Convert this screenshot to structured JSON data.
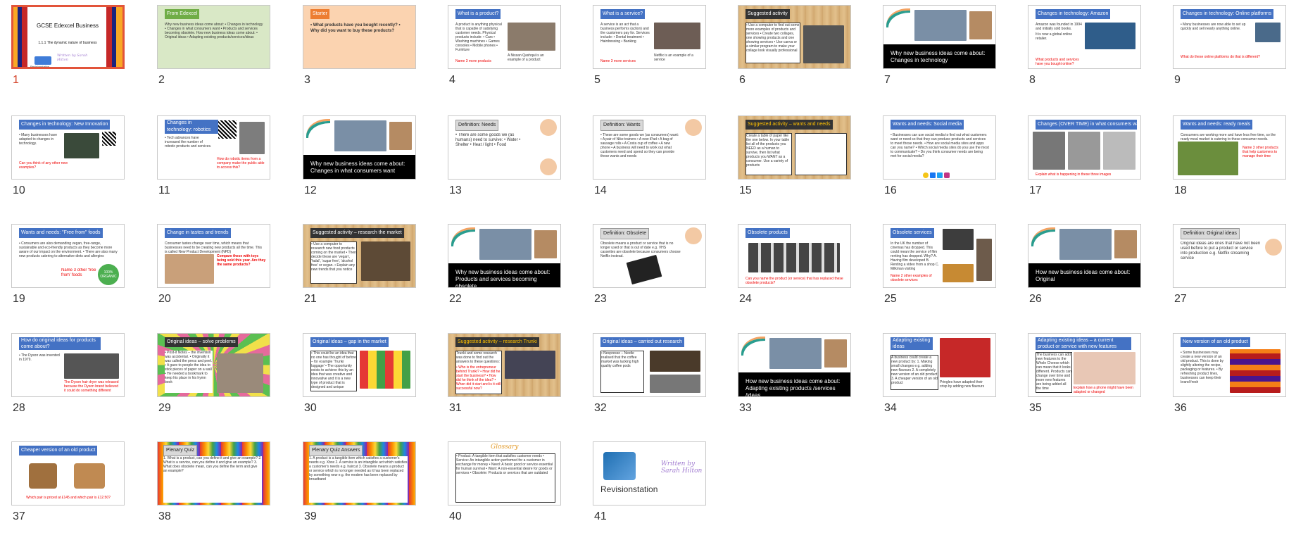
{
  "slides": [
    {
      "number": "1",
      "title": "GCSE Edexcel Business",
      "subtitle": "1.1.1 The dynamic nature of business",
      "brand": "Revisionstation",
      "signature": "Written by Sarah Hilton"
    },
    {
      "number": "2",
      "title": "From Edexcel",
      "body": "Why new business ideas come about: • Changes in technology • Changes in what consumers want • Products and services becoming obsolete. How new business ideas come about: • Original ideas • Adapting existing products/services/ideas"
    },
    {
      "number": "3",
      "title": "Starter",
      "body": "• What products have you bought recently? • Why did you want to buy these products?"
    },
    {
      "number": "4",
      "title": "What is a product?",
      "body": "A product is anything physical that is capable of satisfying customer needs. Physical products include: • Cars • Washing machines • Games consoles • Mobile phones • Furniture",
      "footer": "Name 3 more products",
      "caption": "A Nissan Qashqai is an example of a product"
    },
    {
      "number": "5",
      "title": "What is a service?",
      "body": "A service is an act that a business performs (action) and the customers pay for. Services include: • Dental treatment • Hairdressing • Banking",
      "footer": "Name 3 more services",
      "caption": "Netflix is an example of a service"
    },
    {
      "number": "6",
      "title": "Suggested activity",
      "body": "• Use a computer to find out some more examples of products and services • Create two collages, one showing products and one showing services • Use canva or a similar program to make your collage look visually professional"
    },
    {
      "number": "7",
      "body": "Why new business ideas come about: Changes in technology"
    },
    {
      "number": "8",
      "title": "Changes in technology: Amazon",
      "footer": "What products and services have you bought online?"
    },
    {
      "number": "9",
      "title": "Changes in technology: Online platforms",
      "footer": "What do these online platforms do that is different?"
    },
    {
      "number": "10",
      "title": "Changes in technology: New Innovation",
      "footer": "Can you think of any other new examples?"
    },
    {
      "number": "11",
      "title": "Changes in technology: robotics",
      "footer": "How do robotic items from a company make the public able to access this?"
    },
    {
      "number": "12",
      "body": "Why new business ideas come about: Changes in what consumers want"
    },
    {
      "number": "13",
      "title": "Definition: Needs",
      "body": "• There are some goods we (as humans) need to survive: • Water • Shelter • Heat / light • Food"
    },
    {
      "number": "14",
      "title": "Definition: Wants",
      "body": "• These are some goods we (as consumers) want: • A pair of Nike trainers • A new iPad • A bag of sausage rolls • A Costa cup of coffee • A new phone • A business will need to work out what customers need and spend so they can provide these wants and needs"
    },
    {
      "number": "15",
      "title": "Suggested activity – wants and needs",
      "body": "Create a table of paper like the one below. In your table list all of the products you NEED as a human to survive, then list what products you WANT as a consumer. Use a variety of products"
    },
    {
      "number": "16",
      "title": "Wants and needs: Social media",
      "body": "• Businesses can use social media to find out what customers want or need so that they can produce products and services to meet those needs. • How are social media sites and apps can you name? • Which social media sites do you use the most to communicate? • Do you think consumer needs are being met for social media?"
    },
    {
      "number": "17",
      "title": "Changes (OVER TIME) in what consumers want",
      "footer": "Explain what is happening in these three images"
    },
    {
      "number": "18",
      "title": "Wants and needs: ready meals",
      "body": "Consumers are working more and have less free time, so the ready meal market is catering to these consumer needs.",
      "footer": "Name 3 other products that help customers to manage their time"
    },
    {
      "number": "19",
      "title": "Wants and needs: \"Free from\" foods",
      "body": "• Consumers are also demanding vegan, free-range, sustainable and eco-friendly products as they become more aware of our impact on the environment. • There are also many new products catering to alternative diets and allergies",
      "footer": "Name 3 other 'free from' foods",
      "badge": "100% ORGANIC"
    },
    {
      "number": "20",
      "title": "Change in tastes and trends",
      "body": "Consumer tastes change over time, which means that businesses need to be creating new products all the time. This is called New Product Development (NPD)",
      "footer": "Compare these with toys being sold this year. Are they the same products?"
    },
    {
      "number": "21",
      "title": "Suggested activity – research the market",
      "body": "• Use a computer to research new food products coming on the market • Then decide these are 'vegan', 'halal', 'sugar free', 'alcohol free' or vegan. • Explain any new trends that you notice"
    },
    {
      "number": "22",
      "body": "Why new business ideas come about: Products and services becoming obsolete"
    },
    {
      "number": "23",
      "title": "Definition: Obsolete",
      "body": "Obsolete means a product or service that is no longer used or that is out of date e.g. VHS cassettes are obsolete because consumers choose Netflix instead."
    },
    {
      "number": "24",
      "title": "Obsolete products",
      "footer": "Can you name the product (or service) that has replaced these obsolete products?"
    },
    {
      "number": "25",
      "title": "Obsolete services",
      "body": "In the UK the number of cinemas has dropped. This could mean the service of film renting has dropped. Why? A. Having film developed B. Renting a video from a shop C. Milkman visiting",
      "footer": "Name 2 other examples of obsolete services"
    },
    {
      "number": "26",
      "body": "How new business ideas come about: Original"
    },
    {
      "number": "27",
      "title": "Definition: Original ideas",
      "body": "Original ideas are ones that have not been used before to put a product or service into production e.g. Netflix streaming service"
    },
    {
      "number": "28",
      "title": "How do original ideas for products come about?",
      "footer": "The Dyson hair dryer was released because the Dyson brand believed it could do something different"
    },
    {
      "number": "29",
      "title": "Original ideas – solve problems",
      "body": "• Post-it Notes – the invention was accidental. • Originally it was called the press and peel. • It gave to people the idea to stick pieces of paper on a wall • He needed a bookmark to keep his place in his hymn book"
    },
    {
      "number": "30",
      "title": "Original ideas – gap in the market",
      "body": "• This could be an idea that no one has thought of before – for example 'Trunki luggage' • The opportunity exists to achieve this by an idea that was creative and innovative and it is a new type of product that is designed and unique"
    },
    {
      "number": "31",
      "title": "Suggested activity – research Trunki",
      "body": "Trunki and some research was done to find out the answers to these questions:",
      "footer": "• Who is the entrepreneur behind Trunki? • How did he start the business? • How did he think of the idea? • When did it start and is it still successful now?"
    },
    {
      "number": "32",
      "title": "Original ideas – carried out research",
      "body": "• Nespresso – Nestle realised that the coffee market was lacking high quality coffee pods"
    },
    {
      "number": "33",
      "body": "How new business ideas come about: Adapting existing products /services /ideas"
    },
    {
      "number": "34",
      "title": "Adapting existing ideas",
      "body": "A business could create a new product by: 1. Making small changes e.g. adding new flavours 2. A completely new version of an old product 3. A cheaper version of an old product",
      "footer": "Pringles have adapted their crisp by adding new flavours"
    },
    {
      "number": "35",
      "title": "Adapting existing ideas – a current product or service with new features",
      "body": "The business can add new features to the Whole Cheese which can mean that it looks different. Products can change over time and more new features are being added all the time",
      "footer": "Explain how a phone might have been adapted or changed"
    },
    {
      "number": "36",
      "title": "New version of an old product",
      "body": "• Some businesses may create a new version of an old product. This is done by slightly altering the recipe, packaging or features. • By refreshing product lines, businesses can keep their brand fresh"
    },
    {
      "number": "37",
      "title": "Cheaper version of an old product",
      "footer": "Which pair is priced at £145 and which pair is £12.50?"
    },
    {
      "number": "38",
      "title": "Plenary Quiz",
      "body": "1. What is a product, can you define it and give an example? 2. What is a service, can you define it and give an example? 3. What does obsolete mean, can you define the term and give an example?"
    },
    {
      "number": "39",
      "title": "Plenary Quiz Answers",
      "body": "1. A product is a tangible item which satisfies a customer's needs e.g. Xbox 2. A service is an intangible act which satisfies a customer's needs e.g. haircut 3. Obsolete means a product or service which is no longer needed as it has been replaced by something new e.g. the modem has been replaced by broadband"
    },
    {
      "number": "40",
      "title": "Glossary",
      "body": "• Product: A tangible item that satisfies customer needs • Service: An intangible action performed for a customer in exchange for money • Need: A basic good or service essential for human survival • Want: A non-essential desire for goods or services • Obsolete: Products or services that are outdated"
    },
    {
      "number": "41",
      "brand": "Revisionstation",
      "signature": "Written by Sarah Hilton"
    }
  ]
}
